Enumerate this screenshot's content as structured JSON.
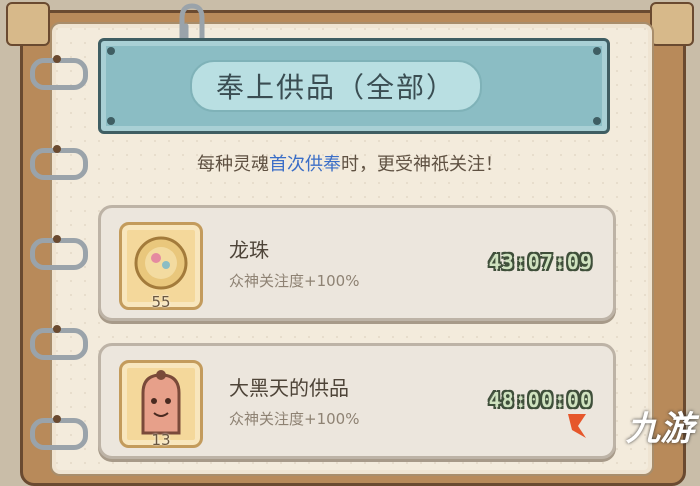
{
  "title": "奉上供品（全部）",
  "subtitle": {
    "before": "每种灵魂",
    "highlight": "首次供奉",
    "after": "时，更受神祇关注！"
  },
  "offerings": [
    {
      "name": "龙珠",
      "desc": "众神关注度+100%",
      "count": "55",
      "timer": "43:07:09",
      "icon": "dragon-pearl-icon"
    },
    {
      "name": "大黑天的供品",
      "desc": "众神关注度+100%",
      "count": "13",
      "timer": "48:00:00",
      "icon": "mahakala-offering-icon"
    }
  ],
  "watermark": "九游",
  "colors": {
    "banner": "#8bbdc4",
    "highlight": "#3b6ec7",
    "timer": "#cfe2bf"
  }
}
